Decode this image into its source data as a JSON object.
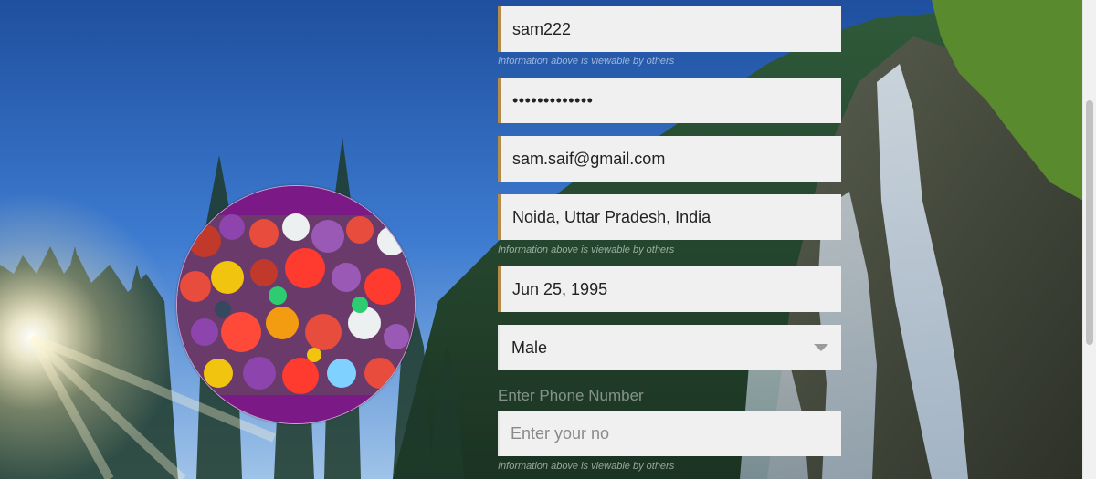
{
  "form": {
    "username": {
      "value": "sam222"
    },
    "username_hint": "Information above is viewable by others",
    "password": {
      "value": "•••••••••••••"
    },
    "email": {
      "value": "sam.saif@gmail.com"
    },
    "location": {
      "value": "Noida, Uttar Pradesh, India"
    },
    "location_hint": "Information above is viewable by others",
    "birthday": {
      "value": "Jun 25, 1995"
    },
    "gender": {
      "value": "Male"
    },
    "phone_label": "Enter Phone Number",
    "phone": {
      "placeholder": "Enter your no",
      "value": ""
    },
    "phone_hint": "Information above is viewable by others"
  },
  "colors": {
    "field_bg": "#f0f0f0",
    "field_accent": "#b58b4a",
    "avatar_band": "#7b1a86",
    "sky": "#2b5fb0"
  },
  "icons": {
    "select_caret": "chevron-down-icon"
  }
}
